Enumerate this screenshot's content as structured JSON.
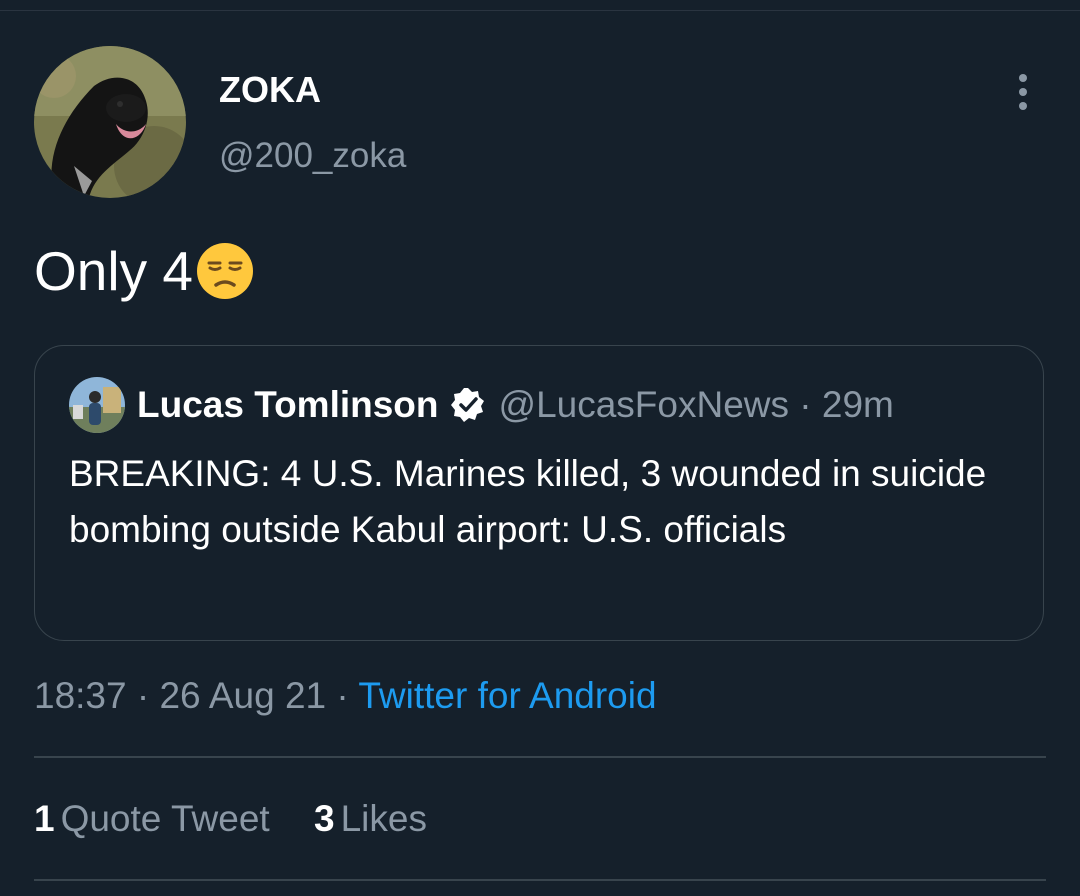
{
  "tweet": {
    "display_name": "ZOKA",
    "handle": "@200_zoka",
    "text": "Only 4",
    "emoji": "unamused-face-icon",
    "more_icon": "more-vertical-icon",
    "timestamp": "18:37 · 26 Aug 21 · ",
    "source": "Twitter for Android"
  },
  "quote": {
    "author_name": "Lucas Tomlinson",
    "verified_icon": "verified-badge-icon",
    "meta": "@LucasFoxNews · 29m",
    "text": "BREAKING: 4 U.S. Marines killed, 3 wounded in suicide bombing outside Kabul airport: U.S. officials"
  },
  "stats": {
    "quote_tweets_count": "1",
    "quote_tweets_label": "Quote Tweet",
    "likes_count": "3",
    "likes_label": "Likes"
  },
  "colors": {
    "background": "#15202b",
    "secondary_text": "#8b98a5",
    "link": "#1d9bf0",
    "border": "#38444d"
  }
}
